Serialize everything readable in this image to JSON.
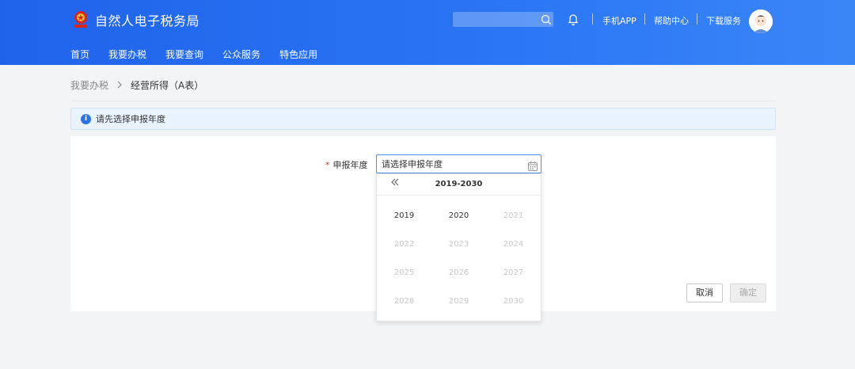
{
  "header": {
    "app_title": "自然人电子税务局",
    "search": {
      "placeholder": ""
    },
    "links": {
      "mobile_app": "手机APP",
      "help_center": "帮助中心",
      "download": "下载服务"
    },
    "nav": [
      "首页",
      "我要办税",
      "我要查询",
      "公众服务",
      "特色应用"
    ]
  },
  "breadcrumb": {
    "parent": "我要办税",
    "current": "经营所得（A表）"
  },
  "notice": {
    "text": "请先选择申报年度"
  },
  "form": {
    "required_mark": "*",
    "year_label": "申报年度",
    "year_placeholder": "请选择申报年度"
  },
  "picker": {
    "range": "2019-2030",
    "years": [
      {
        "label": "2019",
        "enabled": true
      },
      {
        "label": "2020",
        "enabled": true
      },
      {
        "label": "2021",
        "enabled": false
      },
      {
        "label": "2022",
        "enabled": false
      },
      {
        "label": "2023",
        "enabled": false
      },
      {
        "label": "2024",
        "enabled": false
      },
      {
        "label": "2025",
        "enabled": false
      },
      {
        "label": "2026",
        "enabled": false
      },
      {
        "label": "2027",
        "enabled": false
      },
      {
        "label": "2028",
        "enabled": false
      },
      {
        "label": "2029",
        "enabled": false
      },
      {
        "label": "2030",
        "enabled": false
      }
    ]
  },
  "buttons": {
    "cancel": "取消",
    "confirm": "确定"
  },
  "colors": {
    "header_blue": "#2b76f5",
    "accent": "#4e8cf0",
    "required": "#e0392f",
    "emblem_red": "#d9251d",
    "emblem_gold": "#f2c230"
  },
  "icons": {
    "logo": "tax-emblem-icon",
    "search": "search-icon",
    "bell": "bell-icon",
    "calendar": "calendar-icon",
    "prev": "double-chevron-left-icon",
    "info": "info-icon"
  }
}
